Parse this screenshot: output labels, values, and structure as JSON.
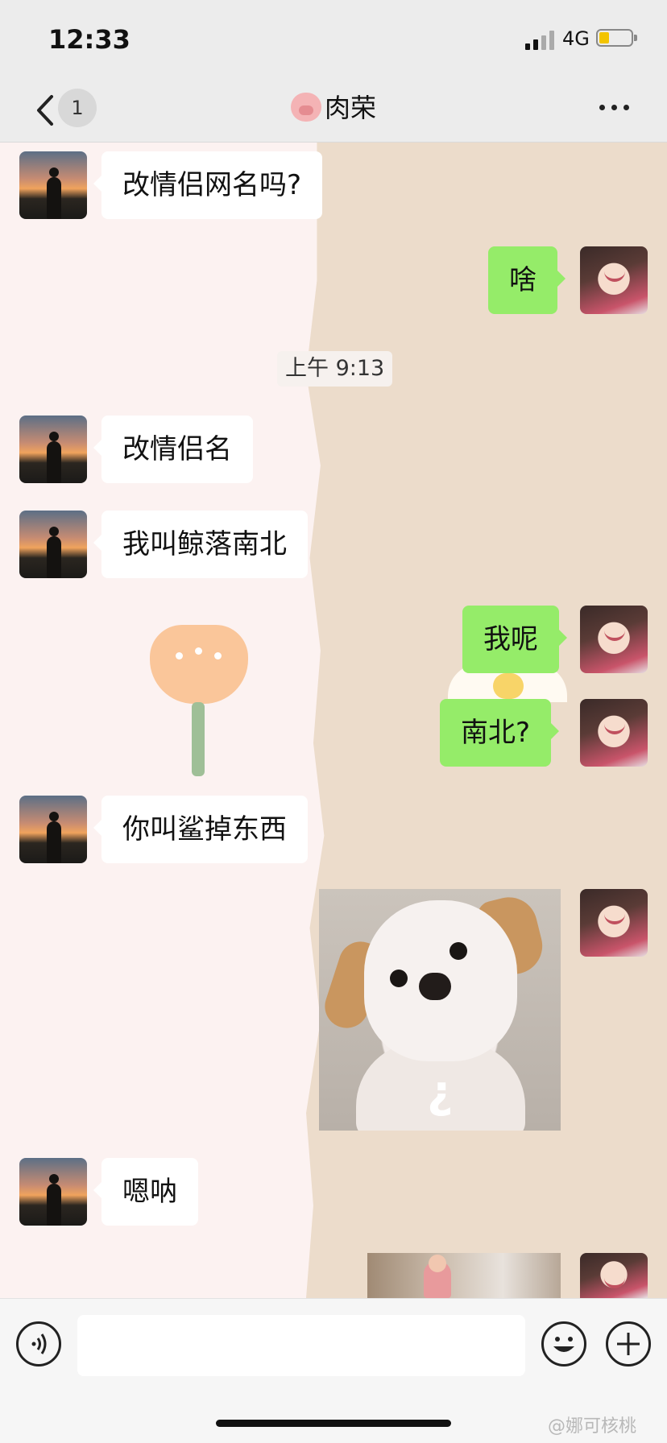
{
  "status_bar": {
    "time": "12:33",
    "network": "4G"
  },
  "nav": {
    "unread_count": "1",
    "contact_name": "肉荣"
  },
  "messages": {
    "m1": "改情侣网名吗?",
    "m2": "啥",
    "timestamp": "上午 9:13",
    "m3": "改情侣名",
    "m4": "我叫鲸落南北",
    "m5": "我呢",
    "m6": "南北?",
    "m7": "你叫鲨掉东西",
    "m8_sticker": "¿",
    "m9": "嗯呐"
  },
  "watermark": "@娜可核桃",
  "colors": {
    "outgoing_bubble": "#95ec69",
    "incoming_bubble": "#ffffff",
    "bar_bg": "#ececec"
  }
}
